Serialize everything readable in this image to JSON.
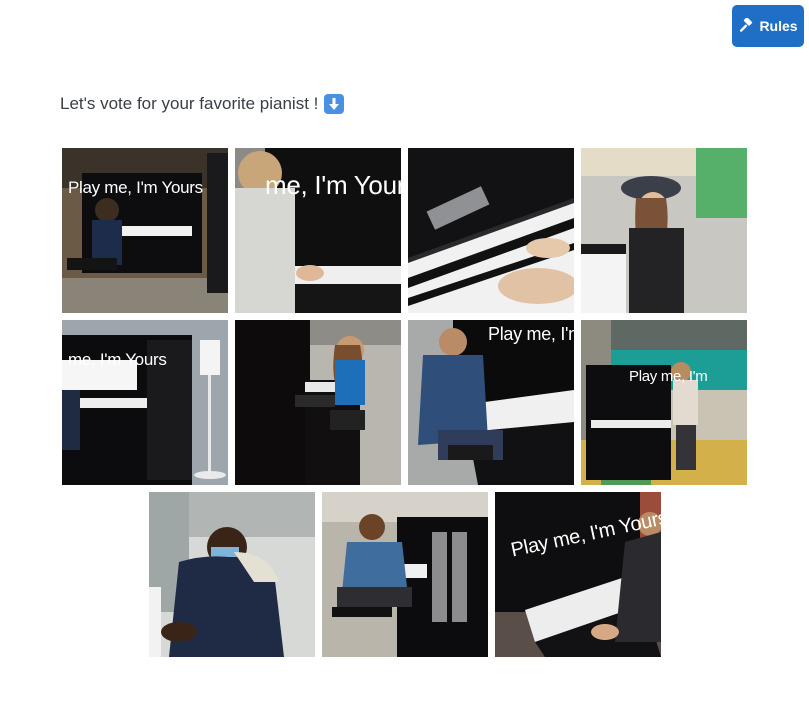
{
  "rules_button": {
    "label": "Rules",
    "icon": "gavel-icon",
    "color": "#1f6fc6"
  },
  "headline": {
    "text": "Let's vote for your favorite pianist !",
    "emoji": "down-arrow-emoji"
  },
  "gallery": {
    "rows": [
      [
        {
          "caption": "Play me, I'm Yours"
        },
        {
          "caption": "me, I'm Your"
        },
        {
          "caption": ""
        },
        {
          "caption": ""
        }
      ],
      [
        {
          "caption": "me, I'm Yours"
        },
        {
          "caption": ""
        },
        {
          "caption": "Play me, I'm Yo"
        },
        {
          "caption": "Play me, I'm"
        }
      ],
      [
        {
          "caption": ""
        },
        {
          "caption": ""
        },
        {
          "caption": "Play me, I'm Yours"
        }
      ]
    ]
  }
}
